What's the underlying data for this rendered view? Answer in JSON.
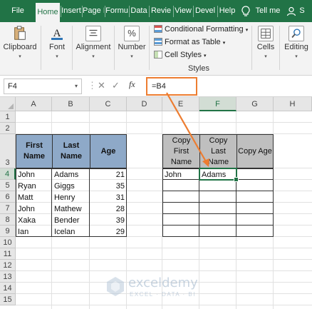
{
  "tabs": [
    "File",
    "Home",
    "Insert",
    "Page I",
    "Formu",
    "Data",
    "Revie",
    "View",
    "Devel",
    "Help",
    "Tell me",
    "S"
  ],
  "ribbon": {
    "clipboard": "Clipboard",
    "font": "Font",
    "alignment": "Alignment",
    "number": "Number",
    "styles_items": [
      "Conditional Formatting",
      "Format as Table",
      "Cell Styles"
    ],
    "styles": "Styles",
    "cells": "Cells",
    "editing": "Editing"
  },
  "formula_bar": {
    "name_box": "F4",
    "cancel": "✕",
    "enter": "✓",
    "fx": "fx",
    "formula": "=B4"
  },
  "grid": {
    "columns": [
      "A",
      "B",
      "C",
      "D",
      "E",
      "F",
      "G",
      "H"
    ],
    "rows": [
      "1",
      "2",
      "3",
      "4",
      "5",
      "6",
      "7",
      "8",
      "9",
      "10",
      "11",
      "12",
      "13",
      "14",
      "15"
    ],
    "selected_column": "F",
    "selected_row": "4"
  },
  "table1": {
    "headers": [
      "First Name",
      "Last Name",
      "Age"
    ],
    "rows": [
      [
        "John",
        "Adams",
        "21"
      ],
      [
        "Ryan",
        "Giggs",
        "35"
      ],
      [
        "Matt",
        "Henry",
        "31"
      ],
      [
        "John",
        "Mathew",
        "28"
      ],
      [
        "Xaka",
        "Bender",
        "39"
      ],
      [
        "Ian",
        "Icelan",
        "29"
      ]
    ]
  },
  "table2": {
    "headers": [
      "Copy First Name",
      "Copy Last Name",
      "Copy Age"
    ],
    "rows": [
      [
        "John",
        "Adams",
        ""
      ],
      [
        "",
        "",
        ""
      ],
      [
        "",
        "",
        ""
      ],
      [
        "",
        "",
        ""
      ],
      [
        "",
        "",
        ""
      ],
      [
        "",
        "",
        ""
      ]
    ]
  },
  "watermark": {
    "name": "exceldemy",
    "tagline": "EXCEL · DATA · BI"
  },
  "colors": {
    "excel_green": "#217346",
    "header_blue": "#8ea9c8",
    "header_gray": "#bfbfbf",
    "arrow_orange": "#ed7d31"
  }
}
